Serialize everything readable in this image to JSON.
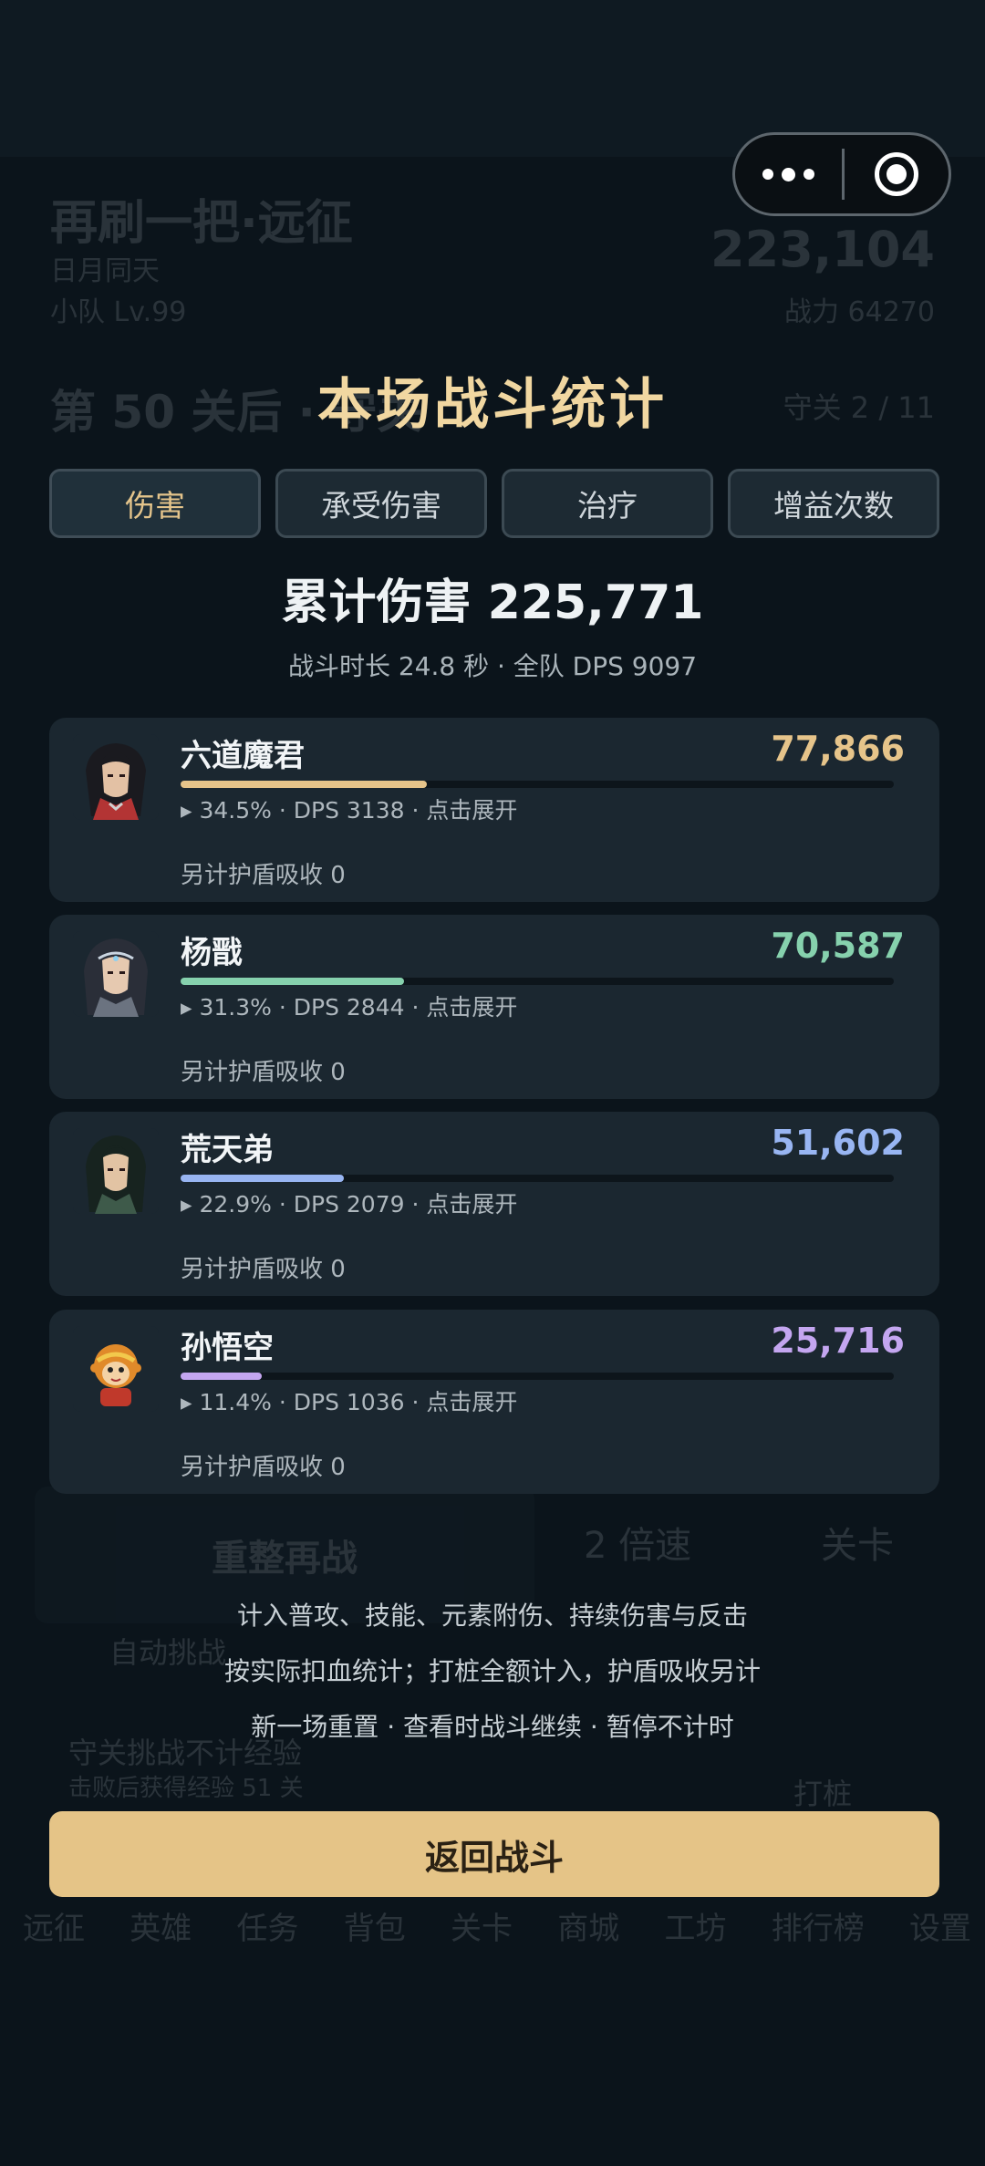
{
  "background": {
    "title": "再刷一把·远征",
    "subtitle": "日月同天",
    "team_level": "小队 Lv.99",
    "power_value": "223,104",
    "power_label": "战力 64270",
    "stage": "第 50 关后 · 守关",
    "stage_progress": "守关 2 / 11",
    "retry_label": "重整再战",
    "speed_label": "2 倍速",
    "level_label": "关卡",
    "auto_label": "自动挑战",
    "guard_label": "守关挑战不计经验",
    "guard_detail": "击败后获得经验 51 关",
    "boss_label": "打桩",
    "nav": [
      "远征",
      "英雄",
      "任务",
      "背包",
      "关卡",
      "商城",
      "工坊",
      "排行榜",
      "设置"
    ]
  },
  "panel": {
    "title": "本场战斗统计",
    "tabs": [
      "伤害",
      "承受伤害",
      "治疗",
      "增益次数"
    ],
    "active_tab": 0,
    "total": "累计伤害 225,771",
    "duration": "战斗时长 24.8 秒 · 全队 DPS 9097"
  },
  "heroes": [
    {
      "name": "六道魔君",
      "value": "77,866",
      "percent": 34.5,
      "meta": "▸ 34.5% · DPS 3138 · 点击展开",
      "shield": "另计护盾吸收 0",
      "color": "#e6c48a",
      "avatar": "dark-lord-portrait"
    },
    {
      "name": "杨戬",
      "value": "70,587",
      "percent": 31.3,
      "meta": "▸ 31.3% · DPS 2844 · 点击展开",
      "shield": "另计护盾吸收 0",
      "color": "#86d1ad",
      "avatar": "yang-jian-portrait"
    },
    {
      "name": "荒天弟",
      "value": "51,602",
      "percent": 22.9,
      "meta": "▸ 22.9% · DPS 2079 · 点击展开",
      "shield": "另计护盾吸收 0",
      "color": "#98b5f2",
      "avatar": "huang-tian-di-portrait"
    },
    {
      "name": "孙悟空",
      "value": "25,716",
      "percent": 11.4,
      "meta": "▸ 11.4% · DPS 1036 · 点击展开",
      "shield": "另计护盾吸收 0",
      "color": "#c4a6f0",
      "avatar": "monkey-king-portrait"
    }
  ],
  "notes": [
    "计入普攻、技能、元素附伤、持续伤害与反击",
    "按实际扣血统计；打桩全额计入，护盾吸收另计",
    "新一场重置 · 查看时战斗继续 · 暂停不计时"
  ],
  "return_button": "返回战斗"
}
